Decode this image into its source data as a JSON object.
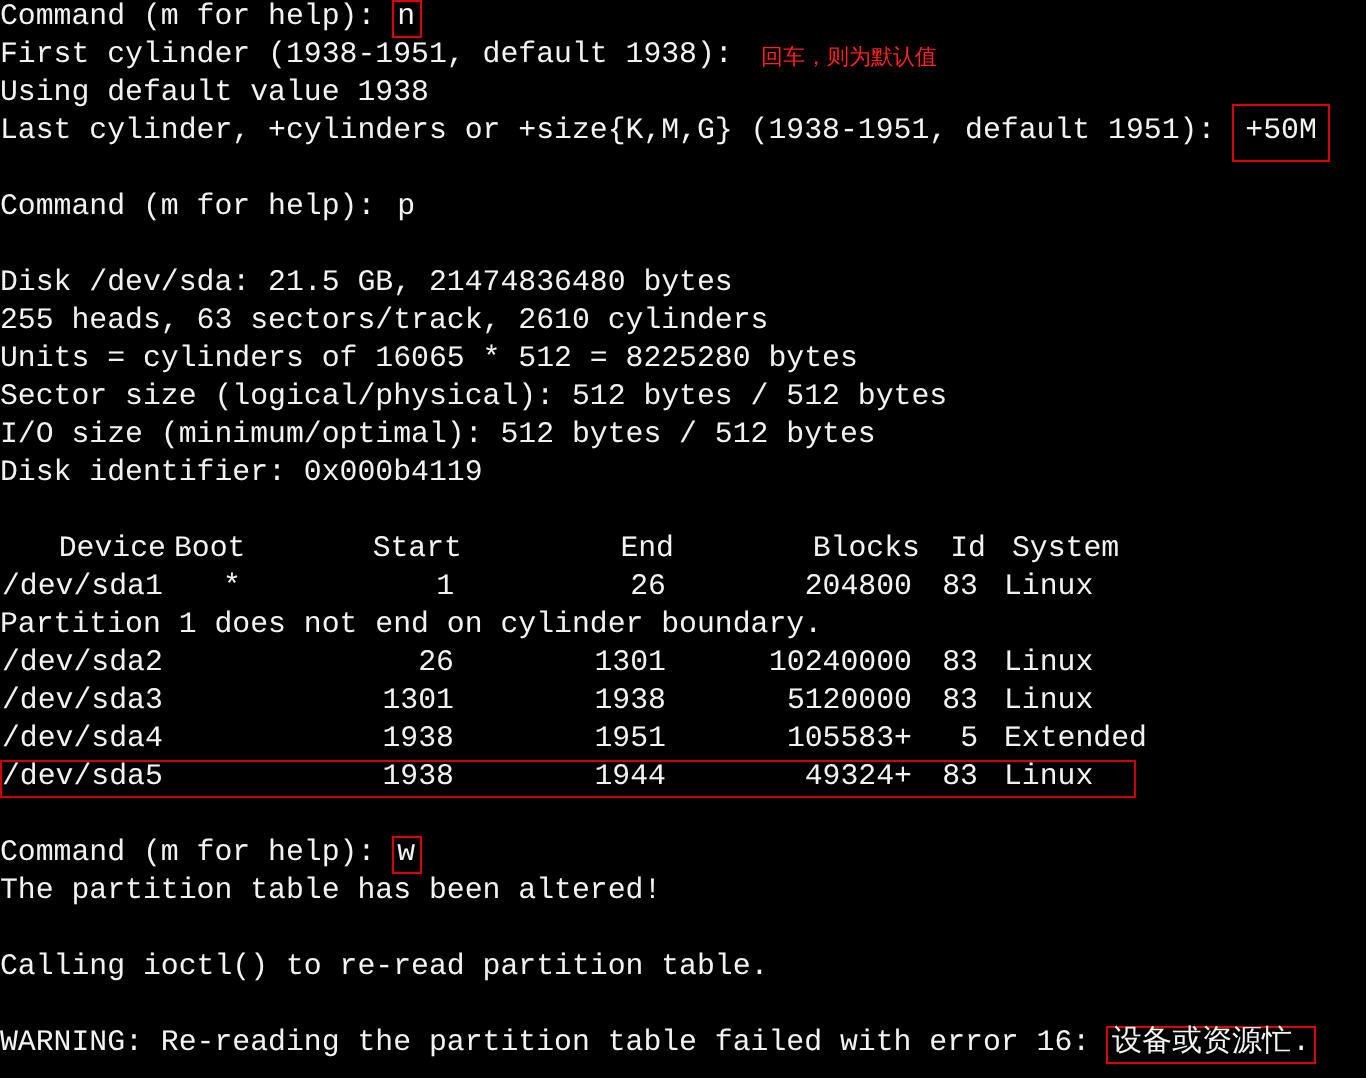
{
  "terminal": {
    "lines": [
      {
        "kind": "prompt",
        "text": "Command (m for help):",
        "input": "n",
        "boxed": true
      },
      {
        "kind": "prompt",
        "text": "First cylinder (1938-1951, default 1938):",
        "note": "回车，则为默认值"
      },
      {
        "kind": "text",
        "text": "Using default value 1938"
      },
      {
        "kind": "prompt",
        "text": "Last cylinder, +cylinders or +size{K,M,G} (1938-1951, default 1951):",
        "input": "+50M",
        "boxed": true
      },
      {
        "kind": "blank"
      },
      {
        "kind": "prompt",
        "text": "Command (m for help):",
        "input": "p",
        "boxed": false
      },
      {
        "kind": "blank"
      },
      {
        "kind": "text",
        "text": "Disk /dev/sda: 21.5 GB, 21474836480 bytes"
      },
      {
        "kind": "text",
        "text": "255 heads, 63 sectors/track, 2610 cylinders"
      },
      {
        "kind": "text",
        "text": "Units = cylinders of 16065 * 512 = 8225280 bytes"
      },
      {
        "kind": "text",
        "text": "Sector size (logical/physical): 512 bytes / 512 bytes"
      },
      {
        "kind": "text",
        "text": "I/O size (minimum/optimal): 512 bytes / 512 bytes"
      },
      {
        "kind": "text",
        "text": "Disk identifier: 0x000b4119"
      },
      {
        "kind": "blank"
      },
      {
        "kind": "table",
        "columns": [
          "Device",
          "Boot",
          "Start",
          "End",
          "Blocks",
          "Id",
          "System"
        ],
        "rows": [
          {
            "kind": "row",
            "cells": [
              "/dev/sda1",
              "*",
              "1",
              "26",
              "204800",
              "83",
              "Linux"
            ],
            "highlighted": false
          },
          {
            "kind": "message",
            "text": "Partition 1 does not end on cylinder boundary."
          },
          {
            "kind": "row",
            "cells": [
              "/dev/sda2",
              "",
              "26",
              "1301",
              "10240000",
              "83",
              "Linux"
            ],
            "highlighted": false
          },
          {
            "kind": "row",
            "cells": [
              "/dev/sda3",
              "",
              "1301",
              "1938",
              "5120000",
              "83",
              "Linux"
            ],
            "highlighted": false
          },
          {
            "kind": "row",
            "cells": [
              "/dev/sda4",
              "",
              "1938",
              "1951",
              "105583+",
              "5",
              "Extended"
            ],
            "highlighted": false
          },
          {
            "kind": "row",
            "cells": [
              "/dev/sda5",
              "",
              "1938",
              "1944",
              "49324+",
              "83",
              "Linux"
            ],
            "highlighted": true
          }
        ]
      },
      {
        "kind": "blank"
      },
      {
        "kind": "prompt",
        "text": "Command (m for help):",
        "input": "w",
        "boxed": true
      },
      {
        "kind": "text",
        "text": "The partition table has been altered!"
      },
      {
        "kind": "blank"
      },
      {
        "kind": "text",
        "text": "Calling ioctl() to re-read partition table."
      },
      {
        "kind": "blank"
      },
      {
        "kind": "prompt",
        "text": "WARNING: Re-reading the partition table failed with error 16:",
        "input": "设备或资源忙.",
        "boxed": true
      }
    ]
  }
}
